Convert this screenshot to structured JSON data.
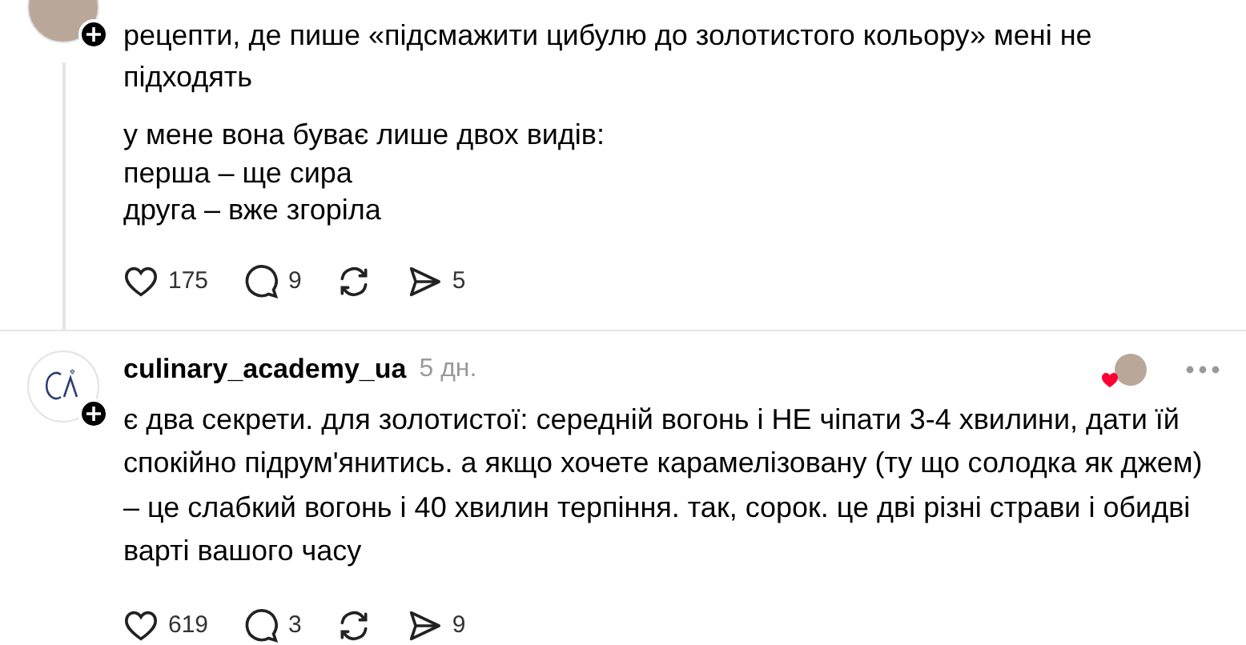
{
  "posts": [
    {
      "creator_liked": false,
      "paragraphs": [
        "рецепти, де пише «підсмажити цибулю до золотистого кольору» мені не підходять",
        "у мене вона буває лише двох видів:\nперша – ще сира\nдруга – вже згоріла"
      ],
      "thread_line": true,
      "avatar": {
        "kind": "photo"
      },
      "stats": {
        "likes": "175",
        "replies": "9",
        "shares": "5"
      }
    },
    {
      "author": "culinary_academy_ua",
      "time": "5 дн.",
      "creator_liked": true,
      "paragraphs": [
        "є два секрети. для золотистої: середній вогонь і НЕ чіпати 3-4 хвилини, дати їй спокійно підрум'янитись. а якщо хочете карамелізовану (ту що солодка як джем) – це слабкий вогонь і 40 хвилин терпіння. так, сорок. це дві різні страви і обидві варті вашого часу"
      ],
      "thread_line": false,
      "avatar": {
        "kind": "logo"
      },
      "stats": {
        "likes": "619",
        "replies": "3",
        "shares": "9"
      }
    }
  ]
}
